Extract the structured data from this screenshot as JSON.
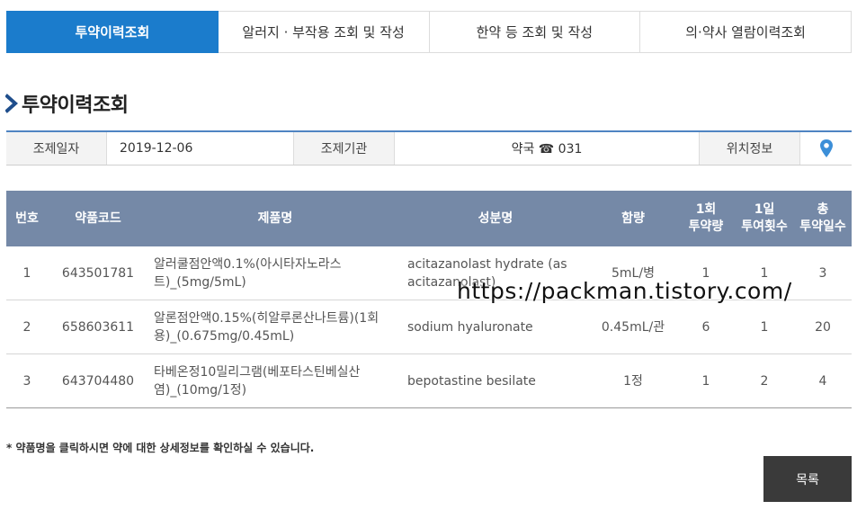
{
  "tabs": [
    {
      "label": "투약이력조회",
      "active": true
    },
    {
      "label": "알러지 · 부작용 조회 및 작성",
      "active": false
    },
    {
      "label": "한약 등 조회 및 작성",
      "active": false
    },
    {
      "label": "의·약사 열람이력조회",
      "active": false
    }
  ],
  "page_title": "투약이력조회",
  "info": {
    "date_label": "조제일자",
    "date_value": "2019-12-06",
    "institution_label": "조제기관",
    "institution_value": "약국 ☎ 031",
    "location_label": "위치정보"
  },
  "table": {
    "headers": {
      "no": "번호",
      "code": "약품코드",
      "product": "제품명",
      "ingredient": "성분명",
      "amount": "함량",
      "dose_a": "1회",
      "dose_b": "투약량",
      "daily_a": "1일",
      "daily_b": "투여횟수",
      "days_a": "총",
      "days_b": "투약일수"
    },
    "rows": [
      {
        "no": "1",
        "code": "643501781",
        "product": "알러쿨점안액0.1%(아시타자노라스트)_(5mg/5mL)",
        "ingredient": "acitazanolast hydrate (as acitazanolast)",
        "amount": "5mL/병",
        "dose": "1",
        "daily": "1",
        "days": "3"
      },
      {
        "no": "2",
        "code": "658603611",
        "product": "알론점안액0.15%(히알루론산나트륨)(1회용)_(0.675mg/0.45mL)",
        "ingredient": "sodium hyaluronate",
        "amount": "0.45mL/관",
        "dose": "6",
        "daily": "1",
        "days": "20"
      },
      {
        "no": "3",
        "code": "643704480",
        "product": "타베온정10밀리그램(베포타스틴베실산염)_(10mg/1정)",
        "ingredient": "bepotastine besilate",
        "amount": "1정",
        "dose": "1",
        "daily": "2",
        "days": "4"
      }
    ]
  },
  "note": "* 약품명을 클릭하시면 약에 대한 상세정보를 확인하실 수 있습니다.",
  "list_button": "목록",
  "watermark": "https://packman.tistory.com/",
  "colors": {
    "accent": "#1b7ccc",
    "table_header": "#7589a7",
    "button": "#3a3a3a",
    "pin": "#3c8fd8"
  },
  "icons": {
    "title": "chevron-right-icon",
    "location": "map-pin-icon"
  }
}
